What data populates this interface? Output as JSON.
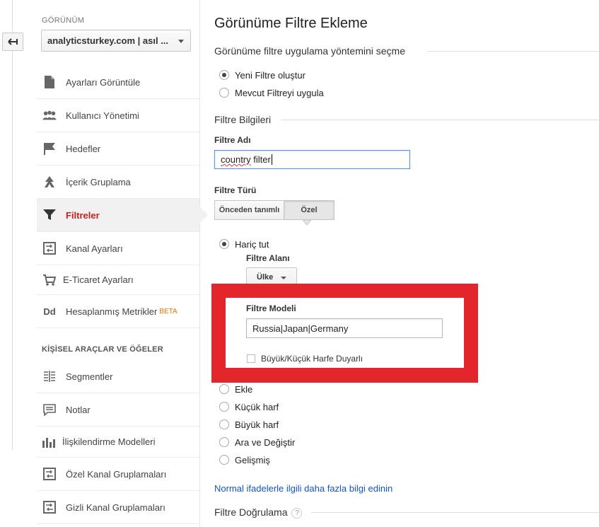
{
  "sidebar": {
    "view_label": "GÖRÜNÜM",
    "view_select": "analyticsturkey.com | asıl ...",
    "items": [
      {
        "label": "Ayarları Görüntüle",
        "icon": "document-icon"
      },
      {
        "label": "Kullanıcı Yönetimi",
        "icon": "users-icon"
      },
      {
        "label": "Hedefler",
        "icon": "flag-icon"
      },
      {
        "label": "İçerik Gruplama",
        "icon": "content-grouping-icon"
      },
      {
        "label": "Filtreler",
        "icon": "filter-icon",
        "active": true
      },
      {
        "label": "Kanal Ayarları",
        "icon": "channel-settings-icon"
      },
      {
        "label": "E-Ticaret Ayarları",
        "icon": "cart-icon"
      },
      {
        "label": "Hesaplanmış Metrikler",
        "icon": "calculated-metrics-icon",
        "badge": "BETA"
      }
    ],
    "section_title": "KİŞİSEL ARAÇLAR VE ÖĞELER",
    "personal_items": [
      {
        "label": "Segmentler",
        "icon": "segments-icon"
      },
      {
        "label": "Notlar",
        "icon": "notes-icon"
      },
      {
        "label": "İlişkilendirme Modelleri",
        "icon": "attribution-icon"
      },
      {
        "label": "Özel Kanal Gruplamaları",
        "icon": "channel-grouping-icon"
      },
      {
        "label": "Gizli Kanal Gruplamaları",
        "icon": "hidden-channel-grouping-icon"
      }
    ]
  },
  "main": {
    "title": "Görünüme Filtre Ekleme",
    "method_heading": "Görünüme filtre uygulama yöntemini seçme",
    "method_options": [
      {
        "label": "Yeni Filtre oluştur",
        "selected": true
      },
      {
        "label": "Mevcut Filtreyi uygula",
        "selected": false
      }
    ],
    "info_heading": "Filtre Bilgileri",
    "filter_name_label": "Filtre Adı",
    "filter_name_value_word": "country",
    "filter_name_value_rest": " filter",
    "filter_type_label": "Filtre Türü",
    "filter_type_tabs": [
      {
        "label": "Önceden tanımlı",
        "selected": false
      },
      {
        "label": "Özel",
        "selected": true
      }
    ],
    "exclude_label": "Hariç tut",
    "filter_field_label": "Filtre Alanı",
    "filter_field_value": "Ülke",
    "filter_pattern_label": "Filtre Modeli",
    "filter_pattern_value": "Russia|Japan|Germany",
    "case_sensitive_label": "Büyük/Küçük Harfe Duyarlı",
    "other_options": [
      "Ekle",
      "Küçük harf",
      "Büyük harf",
      "Ara ve Değiştir",
      "Gelişmiş"
    ],
    "regex_link": "Normal ifadelerle ilgili daha fazla bilgi edinin",
    "verify_heading": "Filtre Doğrulama",
    "help_glyph": "?"
  },
  "colors": {
    "accent_red": "#c5221f",
    "highlight_frame": "#e3262b",
    "link": "#1155cc",
    "beta": "#e37400"
  }
}
